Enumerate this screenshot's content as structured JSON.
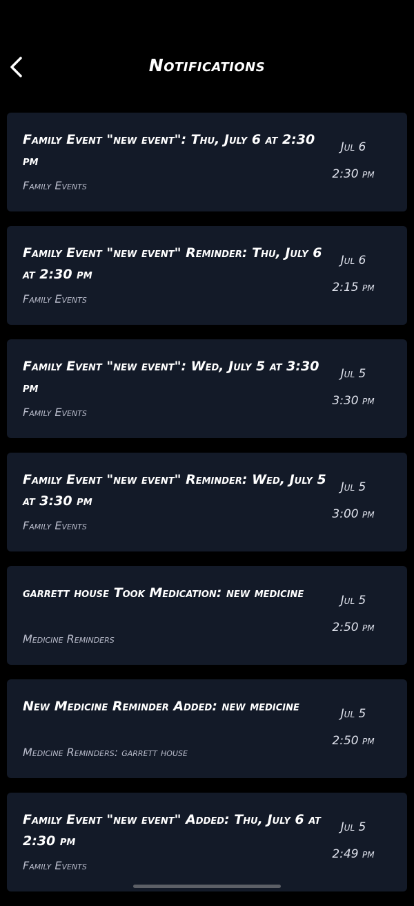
{
  "header": {
    "title": "Notifications",
    "back_icon": "chevron-left-icon"
  },
  "notifications": [
    {
      "title": "Family Event \"new event\":  Thu, July 6 at 2:30 pm",
      "category": "Family Events",
      "date": "Jul 6",
      "time": "2:30 pm"
    },
    {
      "title": "Family Event \"new event\" Reminder: Thu, July 6 at 2:30 pm",
      "category": "Family Events",
      "date": "Jul 6",
      "time": "2:15 pm"
    },
    {
      "title": "Family Event \"new event\":  Wed, July 5 at 3:30 pm",
      "category": "Family Events",
      "date": "Jul 5",
      "time": "3:30 pm"
    },
    {
      "title": "Family Event \"new event\" Reminder: Wed, July 5 at 3:30 pm",
      "category": "Family Events",
      "date": "Jul 5",
      "time": "3:00 pm"
    },
    {
      "title": "garrett house Took Medication: new medicine",
      "category": "Medicine Reminders",
      "date": "Jul 5",
      "time": "2:50 pm"
    },
    {
      "title": "New Medicine Reminder Added: new medicine",
      "category": "Medicine Reminders: garrett house",
      "date": "Jul 5",
      "time": "2:50 pm"
    },
    {
      "title": "Family Event \"new event\" Added: Thu, July 6 at 2:30 pm",
      "category": "Family Events",
      "date": "Jul 5",
      "time": "2:49 pm"
    }
  ],
  "colors": {
    "background": "#000000",
    "card": "#131a28",
    "title_text": "#ffffff",
    "category_text": "#b9bccb"
  }
}
